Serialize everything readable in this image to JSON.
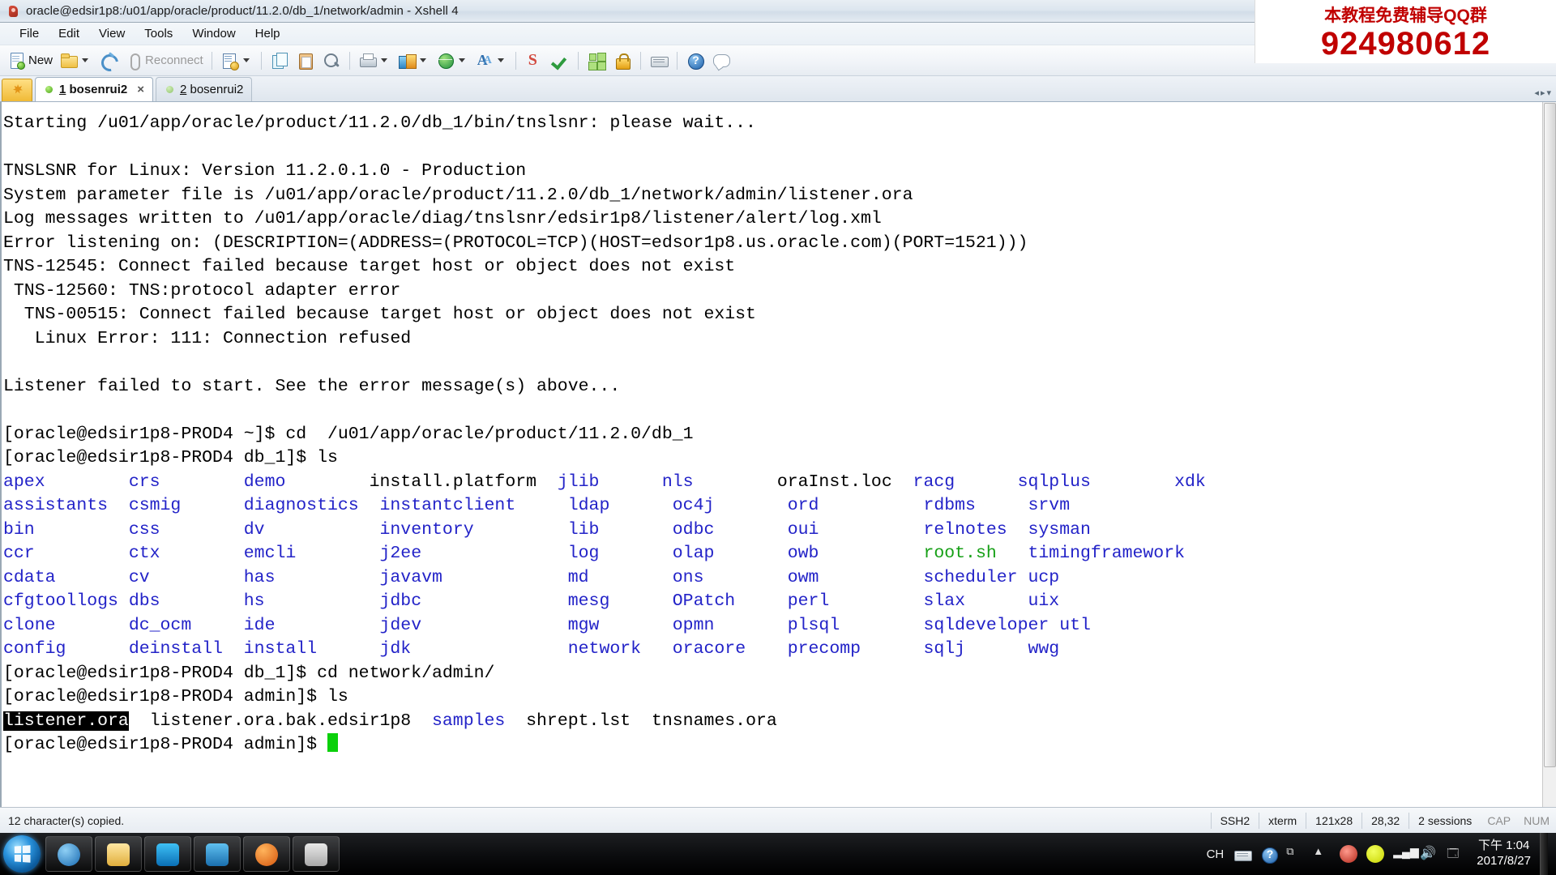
{
  "window": {
    "title": "oracle@edsir1p8:/u01/app/oracle/product/11.2.0/db_1/network/admin - Xshell 4",
    "app_icon": "xshell-icon"
  },
  "watermark": {
    "line1": "本教程免费辅导QQ群",
    "line2": "924980612",
    "color": "#c00000"
  },
  "menu": {
    "items": [
      {
        "label": "File"
      },
      {
        "label": "Edit"
      },
      {
        "label": "View"
      },
      {
        "label": "Tools"
      },
      {
        "label": "Window"
      },
      {
        "label": "Help"
      }
    ]
  },
  "toolbar": {
    "new_label": "New",
    "reconnect_label": "Reconnect",
    "items": [
      {
        "name": "new-session-button",
        "icon": "new-file-icon"
      },
      {
        "name": "open-session-button",
        "icon": "folder-open-icon"
      },
      {
        "name": "connect-button",
        "icon": "plug-icon"
      },
      {
        "name": "reconnect-button",
        "icon": "link-icon"
      },
      {
        "name": "script-button",
        "icon": "script-gear-icon"
      },
      {
        "name": "copy-button",
        "icon": "copy-icon"
      },
      {
        "name": "paste-button",
        "icon": "paste-icon"
      },
      {
        "name": "find-button",
        "icon": "magnifier-icon"
      },
      {
        "name": "print-button",
        "icon": "printer-icon"
      },
      {
        "name": "file-transfer-button",
        "icon": "file-transfer-icon"
      },
      {
        "name": "web-button",
        "icon": "globe-icon"
      },
      {
        "name": "font-button",
        "icon": "font-icon"
      },
      {
        "name": "session-manager-button",
        "icon": "red-s-icon"
      },
      {
        "name": "check-button",
        "icon": "green-check-icon"
      },
      {
        "name": "arrange-button",
        "icon": "grid-icon"
      },
      {
        "name": "lock-button",
        "icon": "lock-icon"
      },
      {
        "name": "keyboard-button",
        "icon": "keyboard-icon"
      },
      {
        "name": "help-button",
        "icon": "help-icon"
      },
      {
        "name": "feedback-button",
        "icon": "chat-icon"
      }
    ]
  },
  "tabs": {
    "add_button_icon": "star-add-icon",
    "items": [
      {
        "index": "1",
        "label": "bosenrui2",
        "active": true,
        "close": "×"
      },
      {
        "index": "2",
        "label": "bosenrui2",
        "active": false,
        "close": ""
      }
    ]
  },
  "terminal": {
    "lines": [
      {
        "segments": [
          {
            "text": "Starting /u01/app/oracle/product/11.2.0/db_1/bin/tnslsnr: please wait...",
            "color": "default"
          }
        ]
      },
      {
        "segments": [
          {
            "text": "",
            "color": "default"
          }
        ]
      },
      {
        "segments": [
          {
            "text": "TNSLSNR for Linux: Version 11.2.0.1.0 - Production",
            "color": "default"
          }
        ]
      },
      {
        "segments": [
          {
            "text": "System parameter file is /u01/app/oracle/product/11.2.0/db_1/network/admin/listener.ora",
            "color": "default"
          }
        ]
      },
      {
        "segments": [
          {
            "text": "Log messages written to /u01/app/oracle/diag/tnslsnr/edsir1p8/listener/alert/log.xml",
            "color": "default"
          }
        ]
      },
      {
        "segments": [
          {
            "text": "Error listening on: (DESCRIPTION=(ADDRESS=(PROTOCOL=TCP)(HOST=edsor1p8.us.oracle.com)(PORT=1521)))",
            "color": "default"
          }
        ]
      },
      {
        "segments": [
          {
            "text": "TNS-12545: Connect failed because target host or object does not exist",
            "color": "default"
          }
        ]
      },
      {
        "segments": [
          {
            "text": " TNS-12560: TNS:protocol adapter error",
            "color": "default"
          }
        ]
      },
      {
        "segments": [
          {
            "text": "  TNS-00515: Connect failed because target host or object does not exist",
            "color": "default"
          }
        ]
      },
      {
        "segments": [
          {
            "text": "   Linux Error: 111: Connection refused",
            "color": "default"
          }
        ]
      },
      {
        "segments": [
          {
            "text": "",
            "color": "default"
          }
        ]
      },
      {
        "segments": [
          {
            "text": "Listener failed to start. See the error message(s) above...",
            "color": "default"
          }
        ]
      },
      {
        "segments": [
          {
            "text": "",
            "color": "default"
          }
        ]
      },
      {
        "segments": [
          {
            "text": "[oracle@edsir1p8-PROD4 ~]$ cd  /u01/app/oracle/product/11.2.0/db_1",
            "color": "default"
          }
        ]
      },
      {
        "segments": [
          {
            "text": "[oracle@edsir1p8-PROD4 db_1]$ ls",
            "color": "default"
          }
        ]
      },
      {
        "segments": [
          {
            "text": "apex        ",
            "color": "blue"
          },
          {
            "text": "crs        ",
            "color": "blue"
          },
          {
            "text": "demo        ",
            "color": "blue"
          },
          {
            "text": "install.platform  ",
            "color": "default"
          },
          {
            "text": "jlib      ",
            "color": "blue"
          },
          {
            "text": "nls        ",
            "color": "blue"
          },
          {
            "text": "oraInst.loc  ",
            "color": "default"
          },
          {
            "text": "racg      ",
            "color": "blue"
          },
          {
            "text": "sqlplus        ",
            "color": "blue"
          },
          {
            "text": "xdk",
            "color": "blue"
          }
        ]
      },
      {
        "segments": [
          {
            "text": "assistants  ",
            "color": "blue"
          },
          {
            "text": "csmig      ",
            "color": "blue"
          },
          {
            "text": "diagnostics  ",
            "color": "blue"
          },
          {
            "text": "instantclient     ",
            "color": "blue"
          },
          {
            "text": "ldap      ",
            "color": "blue"
          },
          {
            "text": "oc4j       ",
            "color": "blue"
          },
          {
            "text": "ord          ",
            "color": "blue"
          },
          {
            "text": "rdbms     ",
            "color": "blue"
          },
          {
            "text": "srvm",
            "color": "blue"
          }
        ]
      },
      {
        "segments": [
          {
            "text": "bin         ",
            "color": "blue"
          },
          {
            "text": "css        ",
            "color": "blue"
          },
          {
            "text": "dv           ",
            "color": "blue"
          },
          {
            "text": "inventory         ",
            "color": "blue"
          },
          {
            "text": "lib       ",
            "color": "blue"
          },
          {
            "text": "odbc       ",
            "color": "blue"
          },
          {
            "text": "oui          ",
            "color": "blue"
          },
          {
            "text": "relnotes  ",
            "color": "blue"
          },
          {
            "text": "sysman",
            "color": "blue"
          }
        ]
      },
      {
        "segments": [
          {
            "text": "ccr         ",
            "color": "blue"
          },
          {
            "text": "ctx        ",
            "color": "blue"
          },
          {
            "text": "emcli        ",
            "color": "blue"
          },
          {
            "text": "j2ee              ",
            "color": "blue"
          },
          {
            "text": "log       ",
            "color": "blue"
          },
          {
            "text": "olap       ",
            "color": "blue"
          },
          {
            "text": "owb          ",
            "color": "blue"
          },
          {
            "text": "root.sh   ",
            "color": "green"
          },
          {
            "text": "timingframework",
            "color": "blue"
          }
        ]
      },
      {
        "segments": [
          {
            "text": "cdata       ",
            "color": "blue"
          },
          {
            "text": "cv         ",
            "color": "blue"
          },
          {
            "text": "has          ",
            "color": "blue"
          },
          {
            "text": "javavm            ",
            "color": "blue"
          },
          {
            "text": "md        ",
            "color": "blue"
          },
          {
            "text": "ons        ",
            "color": "blue"
          },
          {
            "text": "owm          ",
            "color": "blue"
          },
          {
            "text": "scheduler ",
            "color": "blue"
          },
          {
            "text": "ucp",
            "color": "blue"
          }
        ]
      },
      {
        "segments": [
          {
            "text": "cfgtoollogs ",
            "color": "blue"
          },
          {
            "text": "dbs        ",
            "color": "blue"
          },
          {
            "text": "hs           ",
            "color": "blue"
          },
          {
            "text": "jdbc              ",
            "color": "blue"
          },
          {
            "text": "mesg      ",
            "color": "blue"
          },
          {
            "text": "OPatch     ",
            "color": "blue"
          },
          {
            "text": "perl         ",
            "color": "blue"
          },
          {
            "text": "slax      ",
            "color": "blue"
          },
          {
            "text": "uix",
            "color": "blue"
          }
        ]
      },
      {
        "segments": [
          {
            "text": "clone       ",
            "color": "blue"
          },
          {
            "text": "dc_ocm     ",
            "color": "blue"
          },
          {
            "text": "ide          ",
            "color": "blue"
          },
          {
            "text": "jdev              ",
            "color": "blue"
          },
          {
            "text": "mgw       ",
            "color": "blue"
          },
          {
            "text": "opmn       ",
            "color": "blue"
          },
          {
            "text": "plsql        ",
            "color": "blue"
          },
          {
            "text": "sqldeveloper ",
            "color": "blue"
          },
          {
            "text": "utl",
            "color": "blue"
          }
        ]
      },
      {
        "segments": [
          {
            "text": "config      ",
            "color": "blue"
          },
          {
            "text": "deinstall  ",
            "color": "blue"
          },
          {
            "text": "install      ",
            "color": "blue"
          },
          {
            "text": "jdk               ",
            "color": "blue"
          },
          {
            "text": "network   ",
            "color": "blue"
          },
          {
            "text": "oracore    ",
            "color": "blue"
          },
          {
            "text": "precomp      ",
            "color": "blue"
          },
          {
            "text": "sqlj      ",
            "color": "blue"
          },
          {
            "text": "wwg",
            "color": "blue"
          }
        ]
      },
      {
        "segments": [
          {
            "text": "[oracle@edsir1p8-PROD4 db_1]$ cd network/admin/",
            "color": "default"
          }
        ]
      },
      {
        "segments": [
          {
            "text": "[oracle@edsir1p8-PROD4 admin]$ ls",
            "color": "default"
          }
        ]
      },
      {
        "segments": [
          {
            "text": "listener.ora",
            "color": "selected"
          },
          {
            "text": "  listener.ora.bak.edsir1p8  ",
            "color": "default"
          },
          {
            "text": "samples",
            "color": "blue"
          },
          {
            "text": "  shrept.lst  tnsnames.ora",
            "color": "default"
          }
        ]
      },
      {
        "segments": [
          {
            "text": "[oracle@edsir1p8-PROD4 admin]$ ",
            "color": "default"
          },
          {
            "text": "",
            "color": "cursor"
          }
        ]
      }
    ]
  },
  "statusbar": {
    "message": "12 character(s) copied.",
    "protocol": "SSH2",
    "term_type": "xterm",
    "size": "121x28",
    "cursor_pos": "28,32",
    "sessions": "2 sessions",
    "cap": "CAP",
    "num": "NUM"
  },
  "taskbar": {
    "start_icon": "windows-start-orb",
    "buttons": [
      {
        "name": "taskbar-item-browser-blue",
        "icon": "browser-icon",
        "color": "#2f7fd0"
      },
      {
        "name": "taskbar-item-explorer",
        "icon": "folder-icon",
        "color": "#e8c15a"
      },
      {
        "name": "taskbar-item-maxthon",
        "icon": "maxthon-icon",
        "color": "#1a9ae0"
      },
      {
        "name": "taskbar-item-xshell",
        "icon": "xshell-icon",
        "color": "#3b8fd0"
      },
      {
        "name": "taskbar-item-firefox",
        "icon": "firefox-icon",
        "color": "#e8701a"
      },
      {
        "name": "taskbar-item-app",
        "icon": "app-icon",
        "color": "#c8c8c8"
      }
    ],
    "tray": {
      "lang": "CH",
      "icons": [
        "keyboard-icon",
        "help-icon",
        "expand-icon",
        "show-hidden-icon",
        "antivirus-icon",
        "update-icon",
        "network-icon",
        "volume-icon",
        "flash-icon"
      ]
    },
    "clock": {
      "time": "下午 1:04",
      "date": "2017/8/27"
    }
  }
}
